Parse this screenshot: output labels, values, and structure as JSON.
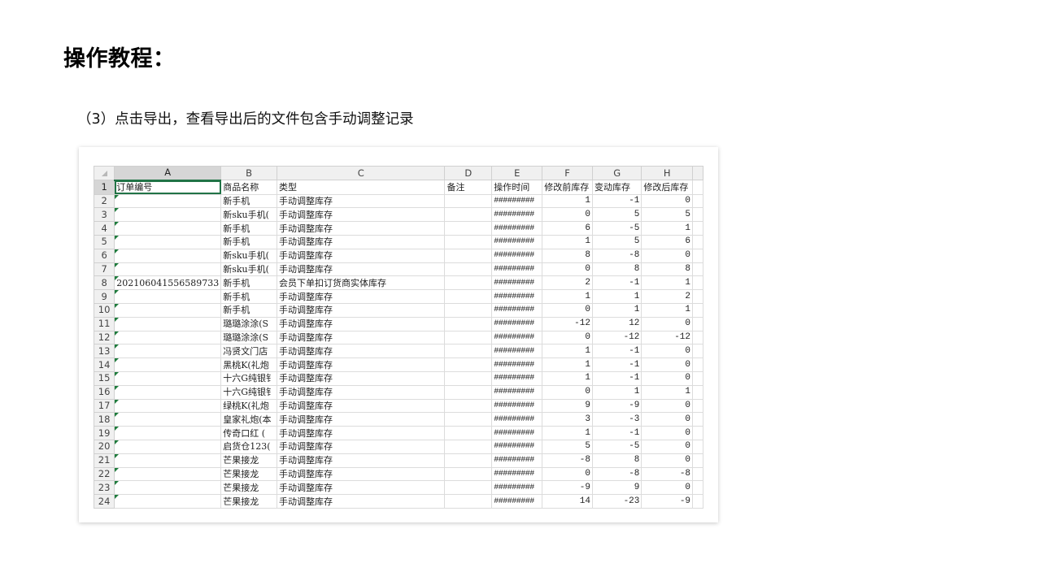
{
  "page": {
    "title": "操作教程：",
    "subtitle": "（3）点击导出，查看导出后的文件包含手动调整记录"
  },
  "sheet": {
    "columns": [
      "A",
      "B",
      "C",
      "D",
      "E",
      "F",
      "G",
      "H"
    ],
    "header_row": {
      "num": "1",
      "cells": [
        "订单编号",
        "商品名称",
        "类型",
        "备注",
        "操作时间",
        "修改前库存",
        "变动库存",
        "修改后库存"
      ]
    },
    "rows": [
      {
        "num": "2",
        "a": "",
        "b": "新手机",
        "c": "手动调整库存",
        "d": "",
        "e": "#########",
        "f": "1",
        "g": "-1",
        "h": "0"
      },
      {
        "num": "3",
        "a": "",
        "b": "新sku手机(",
        "c": "手动调整库存",
        "d": "",
        "e": "#########",
        "f": "0",
        "g": "5",
        "h": "5"
      },
      {
        "num": "4",
        "a": "",
        "b": "新手机",
        "c": "手动调整库存",
        "d": "",
        "e": "#########",
        "f": "6",
        "g": "-5",
        "h": "1"
      },
      {
        "num": "5",
        "a": "",
        "b": "新手机",
        "c": "手动调整库存",
        "d": "",
        "e": "#########",
        "f": "1",
        "g": "5",
        "h": "6"
      },
      {
        "num": "6",
        "a": "",
        "b": "新sku手机(",
        "c": "手动调整库存",
        "d": "",
        "e": "#########",
        "f": "8",
        "g": "-8",
        "h": "0"
      },
      {
        "num": "7",
        "a": "",
        "b": "新sku手机(",
        "c": "手动调整库存",
        "d": "",
        "e": "#########",
        "f": "0",
        "g": "8",
        "h": "8"
      },
      {
        "num": "8",
        "a": "202106041556589733",
        "b": "新手机",
        "c": "会员下单扣订货商实体库存",
        "d": "",
        "e": "#########",
        "f": "2",
        "g": "-1",
        "h": "1"
      },
      {
        "num": "9",
        "a": "",
        "b": "新手机",
        "c": "手动调整库存",
        "d": "",
        "e": "#########",
        "f": "1",
        "g": "1",
        "h": "2"
      },
      {
        "num": "10",
        "a": "",
        "b": "新手机",
        "c": "手动调整库存",
        "d": "",
        "e": "#########",
        "f": "0",
        "g": "1",
        "h": "1"
      },
      {
        "num": "11",
        "a": "",
        "b": "璐璐涂涂(S",
        "c": "手动调整库存",
        "d": "",
        "e": "#########",
        "f": "-12",
        "g": "12",
        "h": "0"
      },
      {
        "num": "12",
        "a": "",
        "b": "璐璐涂涂(S",
        "c": "手动调整库存",
        "d": "",
        "e": "#########",
        "f": "0",
        "g": "-12",
        "h": "-12"
      },
      {
        "num": "13",
        "a": "",
        "b": "冯贤文门店",
        "c": "手动调整库存",
        "d": "",
        "e": "#########",
        "f": "1",
        "g": "-1",
        "h": "0"
      },
      {
        "num": "14",
        "a": "",
        "b": "黑桃K(礼炮",
        "c": "手动调整库存",
        "d": "",
        "e": "#########",
        "f": "1",
        "g": "-1",
        "h": "0"
      },
      {
        "num": "15",
        "a": "",
        "b": "十六G纯银钅",
        "c": "手动调整库存",
        "d": "",
        "e": "#########",
        "f": "1",
        "g": "-1",
        "h": "0"
      },
      {
        "num": "16",
        "a": "",
        "b": "十六G纯银钅",
        "c": "手动调整库存",
        "d": "",
        "e": "#########",
        "f": "0",
        "g": "1",
        "h": "1"
      },
      {
        "num": "17",
        "a": "",
        "b": "绿桃K(礼炮",
        "c": "手动调整库存",
        "d": "",
        "e": "#########",
        "f": "9",
        "g": "-9",
        "h": "0"
      },
      {
        "num": "18",
        "a": "",
        "b": "皇家礼炮(本",
        "c": "手动调整库存",
        "d": "",
        "e": "#########",
        "f": "3",
        "g": "-3",
        "h": "0"
      },
      {
        "num": "19",
        "a": "",
        "b": "传奇口红 (",
        "c": "手动调整库存",
        "d": "",
        "e": "#########",
        "f": "1",
        "g": "-1",
        "h": "0"
      },
      {
        "num": "20",
        "a": "",
        "b": "启货仓123(",
        "c": "手动调整库存",
        "d": "",
        "e": "#########",
        "f": "5",
        "g": "-5",
        "h": "0"
      },
      {
        "num": "21",
        "a": "",
        "b": "芒果接龙",
        "c": "手动调整库存",
        "d": "",
        "e": "#########",
        "f": "-8",
        "g": "8",
        "h": "0"
      },
      {
        "num": "22",
        "a": "",
        "b": "芒果接龙",
        "c": "手动调整库存",
        "d": "",
        "e": "#########",
        "f": "0",
        "g": "-8",
        "h": "-8"
      },
      {
        "num": "23",
        "a": "",
        "b": "芒果接龙",
        "c": "手动调整库存",
        "d": "",
        "e": "#########",
        "f": "-9",
        "g": "9",
        "h": "0"
      },
      {
        "num": "24",
        "a": "",
        "b": "芒果接龙",
        "c": "手动调整库存",
        "d": "",
        "e": "#########",
        "f": "14",
        "g": "-23",
        "h": "-9"
      }
    ]
  }
}
